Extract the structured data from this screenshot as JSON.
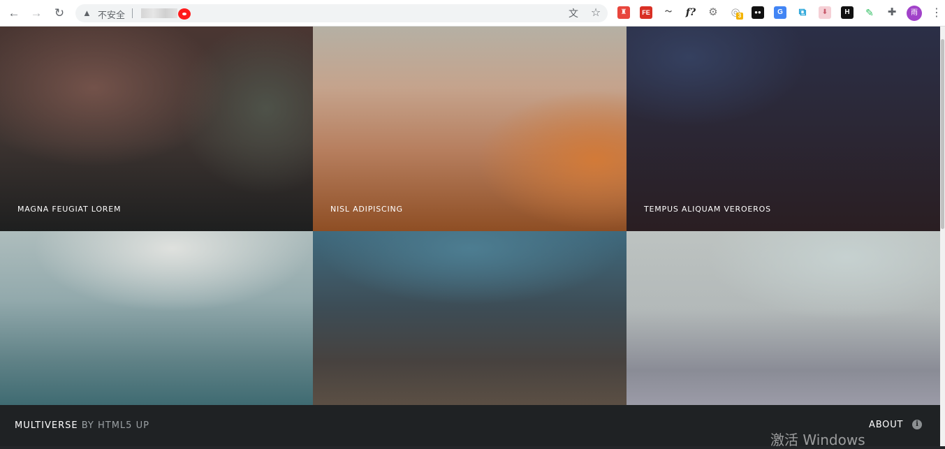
{
  "browser": {
    "security_label": "不安全",
    "extensions": [
      {
        "name": "ext-red-shield",
        "color": "#e8453c",
        "glyph": "♜"
      },
      {
        "name": "ext-fe",
        "color": "#d93025",
        "glyph": "FE"
      },
      {
        "name": "ext-wave",
        "color": "#444444",
        "glyph": "〰"
      },
      {
        "name": "ext-function",
        "color": "#222222",
        "glyph": "f?"
      },
      {
        "name": "ext-gear-badge",
        "color": "#777777",
        "glyph": "⚙"
      },
      {
        "name": "ext-search-badge",
        "color": "#9e9e9e",
        "glyph": "◎",
        "badge": "3"
      },
      {
        "name": "ext-tampermonkey",
        "color": "#111111",
        "glyph": "●●"
      },
      {
        "name": "ext-translate",
        "color": "#4285f4",
        "glyph": "G"
      },
      {
        "name": "ext-screen",
        "color": "#1a9fd6",
        "glyph": "⧉"
      },
      {
        "name": "ext-download",
        "color": "#e07b8c",
        "glyph": "⬇"
      },
      {
        "name": "ext-h",
        "color": "#111111",
        "glyph": "H"
      },
      {
        "name": "ext-evernote",
        "color": "#2dbe60",
        "glyph": "✎"
      },
      {
        "name": "ext-puzzle",
        "color": "#5f6368",
        "glyph": "✚"
      }
    ],
    "profile_initial": "雨"
  },
  "gallery": {
    "tiles": [
      {
        "caption": "MAGNA FEUGIAT LOREM"
      },
      {
        "caption": "NISL ADIPISCING"
      },
      {
        "caption": "TEMPUS ALIQUAM VEROEROS"
      },
      {
        "caption": ""
      },
      {
        "caption": ""
      },
      {
        "caption": ""
      }
    ]
  },
  "footer": {
    "brand_name": "MULTIVERSE",
    "brand_by": "BY HTML5 UP",
    "about_label": "ABOUT",
    "info_icon": "i"
  },
  "system": {
    "watermark": "激活 Windows"
  }
}
